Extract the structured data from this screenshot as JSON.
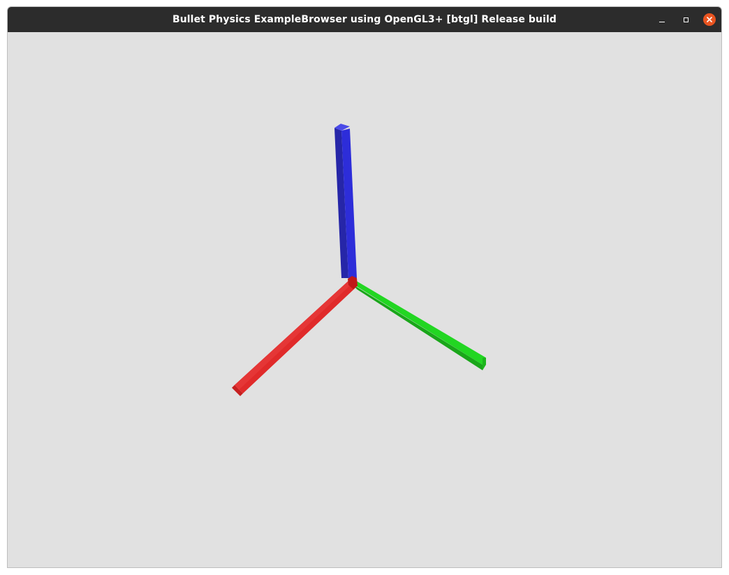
{
  "window": {
    "title": "Bullet Physics ExampleBrowser using OpenGL3+ [btgl] Release build",
    "controls": {
      "minimize_icon": "minimize-icon",
      "maximize_icon": "maximize-icon",
      "close_icon": "close-icon"
    }
  },
  "scene": {
    "background_color": "#e1e1e1",
    "axes": [
      {
        "name": "x-axis",
        "color": "#e02a2a"
      },
      {
        "name": "y-axis",
        "color": "#22d622"
      },
      {
        "name": "z-axis",
        "color": "#2d2dd9"
      }
    ]
  },
  "colors": {
    "titlebar": "#2c2c2c",
    "close_button": "#e95420"
  }
}
